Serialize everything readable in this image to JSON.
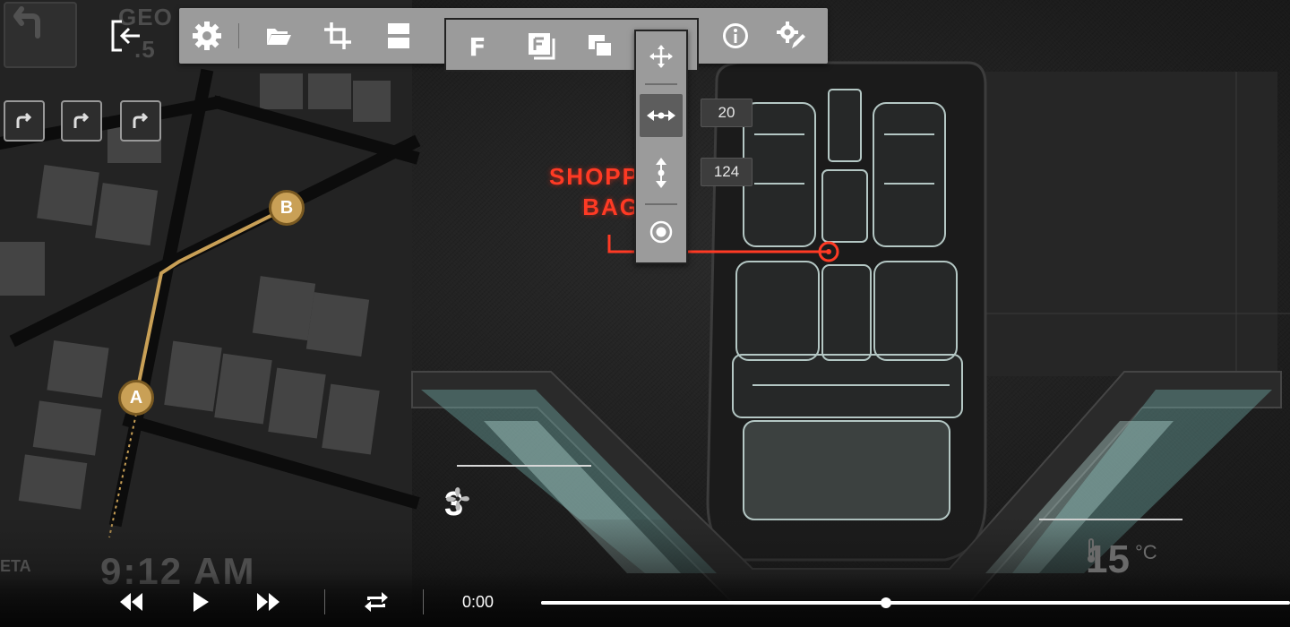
{
  "colors": {
    "toolbar_bg": "#9b9b9b",
    "route_line": "#c9a056",
    "cargo_marker": "#ff3a24",
    "seat_outline": "#cfe6e2"
  },
  "toolbar": {
    "buttons": [
      {
        "name": "exit-icon"
      },
      {
        "name": "gear-icon"
      },
      {
        "name": "folder-open-icon"
      },
      {
        "name": "crop-icon"
      },
      {
        "name": "split-layout-icon"
      },
      {
        "name": "info-icon"
      },
      {
        "name": "settings-edit-icon"
      }
    ],
    "sub_buttons": [
      {
        "name": "font-icon",
        "glyph": "F"
      },
      {
        "name": "framed-font-icon"
      },
      {
        "name": "layers-icon"
      }
    ]
  },
  "adjust_panel": {
    "buttons": [
      {
        "name": "move-icon"
      },
      {
        "name": "horizontal-resize-icon",
        "active": true
      },
      {
        "name": "vertical-resize-icon"
      },
      {
        "name": "target-icon"
      }
    ],
    "horizontal_value": "20",
    "vertical_value": "124"
  },
  "map": {
    "waypoints": [
      {
        "label": "A"
      },
      {
        "label": "B"
      }
    ],
    "top_left_text": "GEO",
    "top_left_text2": ".5"
  },
  "cargo": {
    "label_line1": "SHOPP",
    "label_line2": "BAG"
  },
  "climate": {
    "fan_level": "3",
    "temperature": "15",
    "temperature_unit": "°C"
  },
  "eta": {
    "label": "ETA",
    "time": "9:12 AM"
  },
  "player": {
    "time": "0:00",
    "progress": 0.46
  }
}
